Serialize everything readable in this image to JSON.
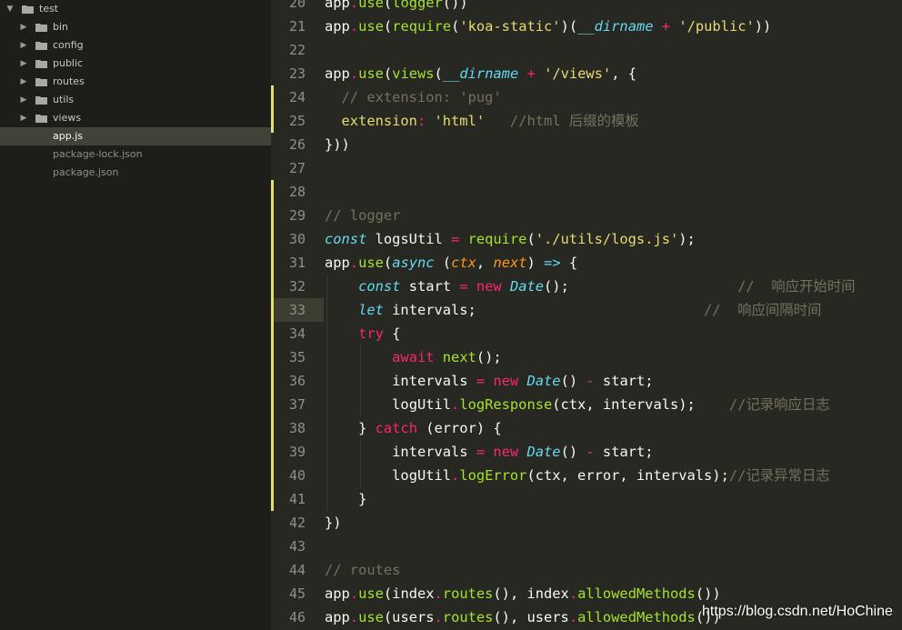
{
  "sidebar": {
    "items": [
      {
        "label": "test",
        "kind": "folder",
        "expanded": true,
        "depth": 0
      },
      {
        "label": "bin",
        "kind": "folder",
        "expanded": false,
        "depth": 1
      },
      {
        "label": "config",
        "kind": "folder",
        "expanded": false,
        "depth": 1
      },
      {
        "label": "public",
        "kind": "folder",
        "expanded": false,
        "depth": 1
      },
      {
        "label": "routes",
        "kind": "folder",
        "expanded": false,
        "depth": 1
      },
      {
        "label": "utils",
        "kind": "folder",
        "expanded": false,
        "depth": 1
      },
      {
        "label": "views",
        "kind": "folder",
        "expanded": false,
        "depth": 1
      },
      {
        "label": "app.js",
        "kind": "file",
        "selected": true,
        "depth": 1
      },
      {
        "label": "package-lock.json",
        "kind": "file",
        "depth": 1
      },
      {
        "label": "package.json",
        "kind": "file",
        "depth": 1
      }
    ]
  },
  "editor": {
    "current_line": 33,
    "modified_lines": [
      [
        24,
        25
      ],
      [
        28,
        41
      ]
    ],
    "lines": [
      {
        "n": 20,
        "indent": 0,
        "tokens": [
          [
            "pl",
            "app"
          ],
          [
            "kw",
            "."
          ],
          [
            "fn",
            "use"
          ],
          [
            "pl",
            "("
          ],
          [
            "fn",
            "logger"
          ],
          [
            "pl",
            "())"
          ]
        ]
      },
      {
        "n": 21,
        "indent": 0,
        "tokens": [
          [
            "pl",
            "app"
          ],
          [
            "kw",
            "."
          ],
          [
            "fn",
            "use"
          ],
          [
            "pl",
            "("
          ],
          [
            "fn",
            "require"
          ],
          [
            "pl",
            "("
          ],
          [
            "str",
            "'koa-static'"
          ],
          [
            "pl",
            ")("
          ],
          [
            "st",
            "__dirname"
          ],
          [
            "pl",
            " "
          ],
          [
            "kw",
            "+"
          ],
          [
            "pl",
            " "
          ],
          [
            "str",
            "'/public'"
          ],
          [
            "pl",
            "))"
          ]
        ]
      },
      {
        "n": 22,
        "indent": 0,
        "tokens": []
      },
      {
        "n": 23,
        "indent": 0,
        "tokens": [
          [
            "pl",
            "app"
          ],
          [
            "kw",
            "."
          ],
          [
            "fn",
            "use"
          ],
          [
            "pl",
            "("
          ],
          [
            "fn",
            "views"
          ],
          [
            "pl",
            "("
          ],
          [
            "st",
            "__dirname"
          ],
          [
            "pl",
            " "
          ],
          [
            "kw",
            "+"
          ],
          [
            "pl",
            " "
          ],
          [
            "str",
            "'/views'"
          ],
          [
            "pl",
            ", {"
          ]
        ]
      },
      {
        "n": 24,
        "indent": 1,
        "tokens": [
          [
            "cm",
            "// extension: 'pug'"
          ]
        ]
      },
      {
        "n": 25,
        "indent": 1,
        "tokens": [
          [
            "ky",
            "extension"
          ],
          [
            "kw",
            ":"
          ],
          [
            "pl",
            " "
          ],
          [
            "str",
            "'html'"
          ],
          [
            "pl",
            "   "
          ],
          [
            "cm",
            "//html 后缀的模板"
          ]
        ]
      },
      {
        "n": 26,
        "indent": 0,
        "tokens": [
          [
            "pl",
            "}))"
          ]
        ]
      },
      {
        "n": 27,
        "indent": 0,
        "tokens": []
      },
      {
        "n": 28,
        "indent": 0,
        "tokens": []
      },
      {
        "n": 29,
        "indent": 0,
        "tokens": [
          [
            "cm",
            "// logger"
          ]
        ]
      },
      {
        "n": 30,
        "indent": 0,
        "tokens": [
          [
            "st",
            "const"
          ],
          [
            "pl",
            " logsUtil "
          ],
          [
            "kw",
            "="
          ],
          [
            "pl",
            " "
          ],
          [
            "fn",
            "require"
          ],
          [
            "pl",
            "("
          ],
          [
            "str",
            "'./utils/logs.js'"
          ],
          [
            "pl",
            ");"
          ]
        ]
      },
      {
        "n": 31,
        "indent": 0,
        "tokens": [
          [
            "pl",
            "app"
          ],
          [
            "kw",
            "."
          ],
          [
            "fn",
            "use"
          ],
          [
            "pl",
            "("
          ],
          [
            "st",
            "async"
          ],
          [
            "pl",
            " ("
          ],
          [
            "pm",
            "ctx"
          ],
          [
            "pl",
            ", "
          ],
          [
            "pm",
            "next"
          ],
          [
            "pl",
            ") "
          ],
          [
            "st",
            "=>"
          ],
          [
            "pl",
            " {"
          ]
        ]
      },
      {
        "n": 32,
        "indent": 2,
        "tokens": [
          [
            "st",
            "const"
          ],
          [
            "pl",
            " start "
          ],
          [
            "kw",
            "="
          ],
          [
            "pl",
            " "
          ],
          [
            "kw",
            "new"
          ],
          [
            "pl",
            " "
          ],
          [
            "st",
            "Date"
          ],
          [
            "pl",
            "();                    "
          ],
          [
            "cm",
            "//  响应开始时间"
          ]
        ]
      },
      {
        "n": 33,
        "indent": 2,
        "tokens": [
          [
            "st",
            "let"
          ],
          [
            "pl",
            " intervals;                           "
          ],
          [
            "cm",
            "//  响应间隔时间"
          ]
        ]
      },
      {
        "n": 34,
        "indent": 2,
        "tokens": [
          [
            "kw",
            "try"
          ],
          [
            "pl",
            " {"
          ]
        ]
      },
      {
        "n": 35,
        "indent": 4,
        "tokens": [
          [
            "kw",
            "await"
          ],
          [
            "pl",
            " "
          ],
          [
            "fn",
            "next"
          ],
          [
            "pl",
            "();"
          ]
        ]
      },
      {
        "n": 36,
        "indent": 4,
        "tokens": [
          [
            "pl",
            "intervals "
          ],
          [
            "kw",
            "="
          ],
          [
            "pl",
            " "
          ],
          [
            "kw",
            "new"
          ],
          [
            "pl",
            " "
          ],
          [
            "st",
            "Date"
          ],
          [
            "pl",
            "() "
          ],
          [
            "kw",
            "-"
          ],
          [
            "pl",
            " start;"
          ]
        ]
      },
      {
        "n": 37,
        "indent": 4,
        "tokens": [
          [
            "pl",
            "logUtil"
          ],
          [
            "kw",
            "."
          ],
          [
            "fn",
            "logResponse"
          ],
          [
            "pl",
            "(ctx, intervals);    "
          ],
          [
            "cm",
            "//记录响应日志"
          ]
        ]
      },
      {
        "n": 38,
        "indent": 2,
        "tokens": [
          [
            "pl",
            "} "
          ],
          [
            "kw",
            "catch"
          ],
          [
            "pl",
            " (error) {"
          ]
        ]
      },
      {
        "n": 39,
        "indent": 4,
        "tokens": [
          [
            "pl",
            "intervals "
          ],
          [
            "kw",
            "="
          ],
          [
            "pl",
            " "
          ],
          [
            "kw",
            "new"
          ],
          [
            "pl",
            " "
          ],
          [
            "st",
            "Date"
          ],
          [
            "pl",
            "() "
          ],
          [
            "kw",
            "-"
          ],
          [
            "pl",
            " start;"
          ]
        ]
      },
      {
        "n": 40,
        "indent": 4,
        "tokens": [
          [
            "pl",
            "logUtil"
          ],
          [
            "kw",
            "."
          ],
          [
            "fn",
            "logError"
          ],
          [
            "pl",
            "(ctx, error, intervals);"
          ],
          [
            "cm",
            "//记录异常日志"
          ]
        ]
      },
      {
        "n": 41,
        "indent": 2,
        "tokens": [
          [
            "pl",
            "}"
          ]
        ]
      },
      {
        "n": 42,
        "indent": 0,
        "tokens": [
          [
            "pl",
            "})"
          ]
        ]
      },
      {
        "n": 43,
        "indent": 0,
        "tokens": []
      },
      {
        "n": 44,
        "indent": 0,
        "tokens": [
          [
            "cm",
            "// routes"
          ]
        ]
      },
      {
        "n": 45,
        "indent": 0,
        "tokens": [
          [
            "pl",
            "app"
          ],
          [
            "kw",
            "."
          ],
          [
            "fn",
            "use"
          ],
          [
            "pl",
            "(index"
          ],
          [
            "kw",
            "."
          ],
          [
            "fn",
            "routes"
          ],
          [
            "pl",
            "(), index"
          ],
          [
            "kw",
            "."
          ],
          [
            "fn",
            "allowedMethods"
          ],
          [
            "pl",
            "())"
          ]
        ]
      },
      {
        "n": 46,
        "indent": 0,
        "tokens": [
          [
            "pl",
            "app"
          ],
          [
            "kw",
            "."
          ],
          [
            "fn",
            "use"
          ],
          [
            "pl",
            "(users"
          ],
          [
            "kw",
            "."
          ],
          [
            "fn",
            "routes"
          ],
          [
            "pl",
            "(), users"
          ],
          [
            "kw",
            "."
          ],
          [
            "fn",
            "allowedMethods"
          ],
          [
            "pl",
            "())"
          ]
        ]
      }
    ]
  },
  "watermark": "https://blog.csdn.net/HoChine",
  "colors": {
    "background": "#272822",
    "sidebar": "#1d1e1a",
    "keyword": "#f92672",
    "function": "#a6e22e",
    "string": "#e6db74",
    "comment": "#75715e",
    "storage": "#66d9ef",
    "parameter": "#fd971f"
  }
}
